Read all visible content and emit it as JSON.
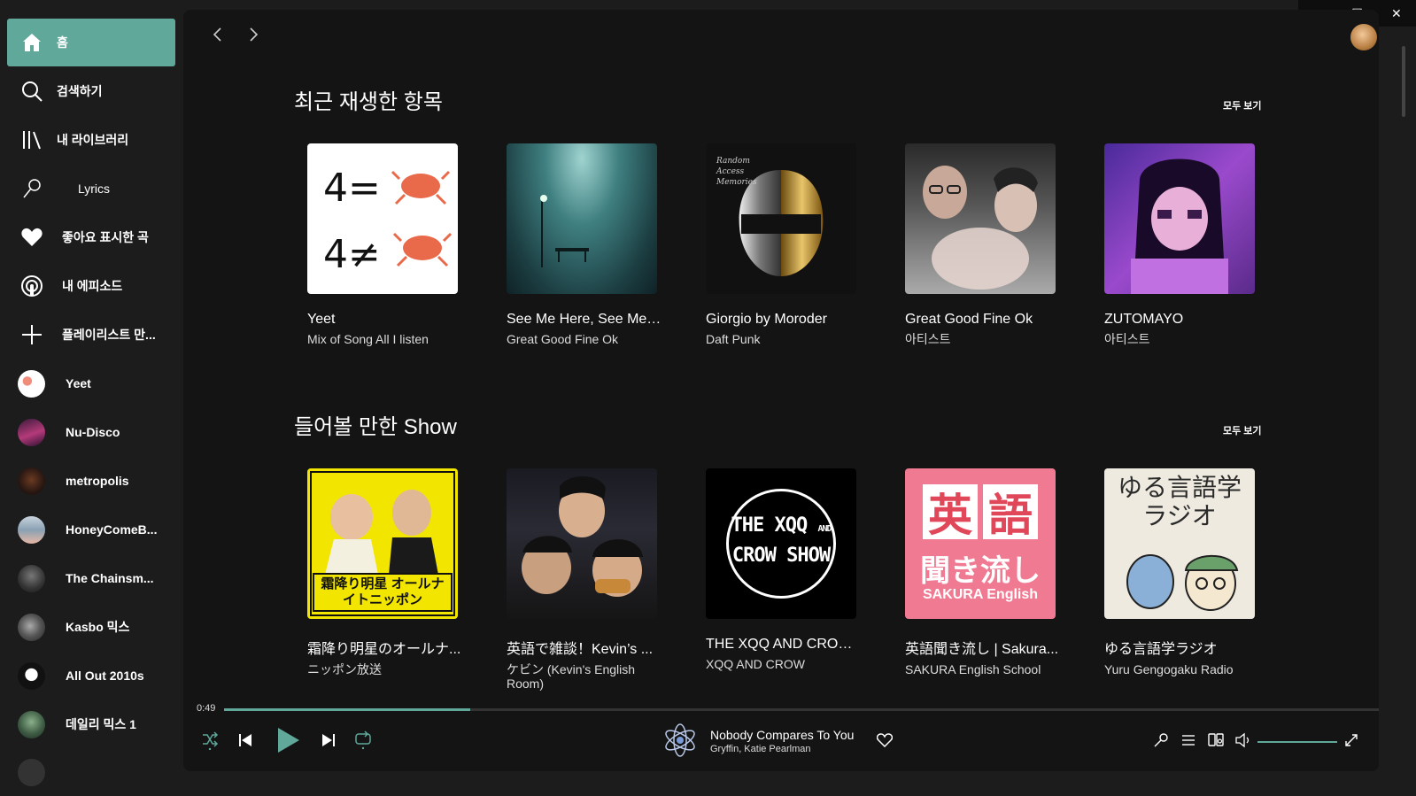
{
  "sidebar": {
    "nav": [
      {
        "label": "홈",
        "icon": "home-icon"
      },
      {
        "label": "검색하기",
        "icon": "search-icon"
      },
      {
        "label": "내 라이브러리",
        "icon": "library-icon"
      },
      {
        "label": "Lyrics",
        "icon": "microphone-icon"
      },
      {
        "label": "좋아요 표시한 곡",
        "icon": "heart-icon"
      },
      {
        "label": "내 에피소드",
        "icon": "podcast-icon"
      },
      {
        "label": "플레이리스트 만...",
        "icon": "plus-icon"
      }
    ],
    "playlists": [
      {
        "label": "Yeet"
      },
      {
        "label": "Nu-Disco"
      },
      {
        "label": "metropolis"
      },
      {
        "label": "HoneyComeB..."
      },
      {
        "label": "The Chainsm..."
      },
      {
        "label": "Kasbo 믹스"
      },
      {
        "label": "All Out 2010s"
      },
      {
        "label": "데일리 믹스 1"
      }
    ]
  },
  "main": {
    "sections": [
      {
        "title": "최근 재생한 항목",
        "see_all": "모두 보기",
        "cards": [
          {
            "title": "Yeet",
            "subtitle": "Mix of Song All I listen"
          },
          {
            "title": "See Me Here, See Me ...",
            "subtitle": "Great Good Fine Ok"
          },
          {
            "title": "Giorgio by Moroder",
            "subtitle": "Daft Punk"
          },
          {
            "title": "Great Good Fine Ok",
            "subtitle": "아티스트"
          },
          {
            "title": "ZUTOMAYO",
            "subtitle": "아티스트"
          }
        ]
      },
      {
        "title": "들어볼 만한 Show",
        "see_all": "모두 보기",
        "cards": [
          {
            "title": "霜降り明星のオールナ...",
            "subtitle": "ニッポン放送",
            "cover_text": "霜降り明星 オールナイトニッポン"
          },
          {
            "title": "英語で雑談！Kevin’s ...",
            "subtitle": "ケビン (Kevin's English Room)"
          },
          {
            "title": "THE XQQ AND CROW ...",
            "subtitle": "XQQ AND CROW",
            "cover_text_1": "THE XQQ",
            "cover_text_and": "AND",
            "cover_text_2": "CROW SHOW"
          },
          {
            "title": "英語聞き流し | Sakura...",
            "subtitle": "SAKURA English School",
            "cover_text_1": "英",
            "cover_text_2": "語",
            "cover_text_3": "聞き流し",
            "cover_text_4": "SAKURA English"
          },
          {
            "title": "ゆる言語学ラジオ",
            "subtitle": "Yuru Gengogaku Radio",
            "cover_text": "ゆる言語学ラジオ"
          }
        ]
      }
    ]
  },
  "player": {
    "elapsed": "0:49",
    "progress": 0.213,
    "track_title": "Nobody Compares To You",
    "track_artist": "Gryffin, Katie Pearlman",
    "volume": 1.0
  },
  "colors": {
    "accent": "#5fa89a",
    "background": "#1c1c1c",
    "panel": "#141414"
  }
}
